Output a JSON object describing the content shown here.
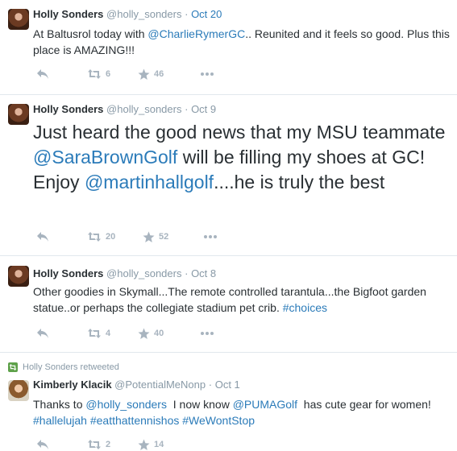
{
  "tweets": [
    {
      "name": "Holly Sonders",
      "handle": "@holly_sonders",
      "sep": "·",
      "time": "Oct 20",
      "segments": [
        {
          "t": "At Baltusrol today with ",
          "link": false
        },
        {
          "t": "@CharlieRymerGC",
          "link": true
        },
        {
          "t": ".. Reunited and it feels so good. Plus this place is AMAZING!!!",
          "link": false
        }
      ],
      "retweets": "6",
      "favorites": "46"
    },
    {
      "name": "Holly Sonders",
      "handle": "@holly_sonders",
      "sep": "·",
      "time": "Oct 9",
      "segments": [
        {
          "t": "Just heard the good news that my MSU teammate ",
          "link": false
        },
        {
          "t": "@SaraBrownGolf",
          "link": true
        },
        {
          "t": " will be filling my shoes at GC! Enjoy ",
          "link": false
        },
        {
          "t": "@martinhallgolf",
          "link": true
        },
        {
          "t": "....he is truly the best",
          "link": false
        }
      ],
      "retweets": "20",
      "favorites": "52"
    },
    {
      "name": "Holly Sonders",
      "handle": "@holly_sonders",
      "sep": "·",
      "time": "Oct 8",
      "segments": [
        {
          "t": "Other goodies in Skymall...The remote controlled tarantula...the Bigfoot garden statue..or perhaps the collegiate stadium pet crib. ",
          "link": false
        },
        {
          "t": "#choices",
          "link": true
        }
      ],
      "retweets": "4",
      "favorites": "40"
    },
    {
      "retweet_context": "Holly Sonders retweeted",
      "name": "Kimberly Klacik",
      "handle": "@PotentialMeNonp",
      "sep": "·",
      "time": "Oct 1",
      "segments": [
        {
          "t": "Thanks to ",
          "link": false
        },
        {
          "t": "@holly_sonders",
          "link": true
        },
        {
          "t": "  I now know ",
          "link": false
        },
        {
          "t": "@PUMAGolf",
          "link": true
        },
        {
          "t": "  has cute gear for women! ",
          "link": false
        },
        {
          "t": "#hallelujah",
          "link": true
        },
        {
          "t": " ",
          "link": false
        },
        {
          "t": "#eatthattennishos",
          "link": true
        },
        {
          "t": " ",
          "link": false
        },
        {
          "t": "#WeWontStop",
          "link": true
        }
      ],
      "retweets": "2",
      "favorites": "14"
    }
  ],
  "colors": {
    "link": "#2b7bb9",
    "meta": "#8899a6",
    "action_icon": "#a8b4bf",
    "divider": "#e1e8ed",
    "retweet_badge": "#5ea14a"
  },
  "icons": [
    "reply-icon",
    "retweet-icon",
    "favorite-star-icon",
    "more-dots-icon"
  ]
}
